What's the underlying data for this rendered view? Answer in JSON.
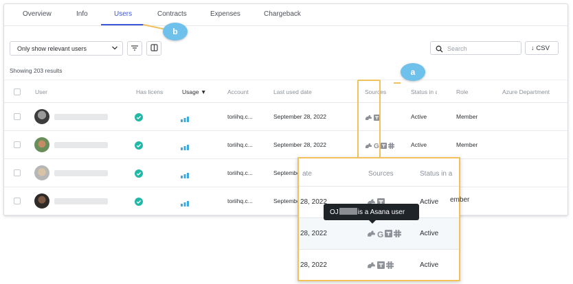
{
  "tabs": [
    {
      "label": "Overview"
    },
    {
      "label": "Info"
    },
    {
      "label": "Users"
    },
    {
      "label": "Contracts"
    },
    {
      "label": "Expenses"
    },
    {
      "label": "Chargeback"
    }
  ],
  "active_tab": "Users",
  "filter": {
    "selected": "Only show relevant users"
  },
  "search": {
    "placeholder": "Search"
  },
  "csv_button": {
    "label": "CSV"
  },
  "results_text": "Showing 203 results",
  "columns": [
    "User",
    "Has licens",
    "Usage",
    "Account",
    "Last used date",
    "Sources",
    "Status in a",
    "Role",
    "Azure Department"
  ],
  "sort_indicator": "▼",
  "rows": [
    {
      "account": "toriihq.c...",
      "last_used": "September 28, 2022",
      "status": "Active",
      "role": "Member"
    },
    {
      "account": "toriihq.c...",
      "last_used": "September 28, 2022",
      "status": "Active",
      "role": "Member"
    },
    {
      "account": "toriihq.c...",
      "last_used": "Septembe",
      "status": "",
      "role": ""
    },
    {
      "account": "toriihq.c...",
      "last_used": "Septembe",
      "status": "",
      "role": ""
    }
  ],
  "markers": {
    "a": "a",
    "b": "b"
  },
  "zoom": {
    "headers": {
      "date_partial": "ate",
      "sources": "Sources",
      "status": "Status in a"
    },
    "rows": [
      {
        "date": "28, 2022",
        "status": "Active",
        "role_partial": "ember"
      },
      {
        "date": "28, 2022",
        "status": "Active",
        "role_partial": ""
      },
      {
        "date": "28, 2022",
        "status": "Active",
        "role_partial": ""
      }
    ]
  },
  "tooltip": {
    "prefix": "OJ",
    "suffix": "is a Asana user"
  },
  "colors": {
    "accent": "#3b56d9",
    "highlight": "#f2c15b",
    "marker": "#6ec1ea",
    "check": "#22b8a7"
  },
  "icons": [
    "plug-icon",
    "google-icon",
    "table-icon",
    "slack-icon",
    "check-circle-icon",
    "usage-bars-icon"
  ]
}
